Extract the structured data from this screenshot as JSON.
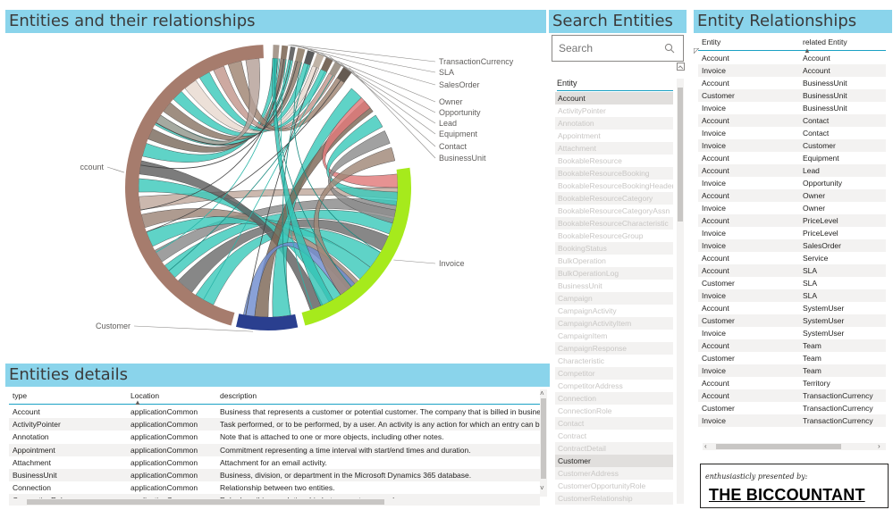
{
  "headers": {
    "chord": "Entities and their relationships",
    "search": "Search Entities",
    "relationships": "Entity Relationships",
    "details": "Entities details"
  },
  "search": {
    "placeholder": "Search",
    "list_header": "Entity"
  },
  "entity_list": [
    "Account",
    "ActivityPointer",
    "Annotation",
    "Appointment",
    "Attachment",
    "BookableResource",
    "BookableResourceBooking",
    "BookableResourceBookingHeader",
    "BookableResourceCategory",
    "BookableResourceCategoryAssn",
    "BookableResourceCharacteristic",
    "BookableResourceGroup",
    "BookingStatus",
    "BulkOperation",
    "BulkOperationLog",
    "BusinessUnit",
    "Campaign",
    "CampaignActivity",
    "CampaignActivityItem",
    "CampaignItem",
    "CampaignResponse",
    "Characteristic",
    "Competitor",
    "CompetitorAddress",
    "Connection",
    "ConnectionRole",
    "Contact",
    "Contract",
    "ContractDetail",
    "Customer",
    "CustomerAddress",
    "CustomerOpportunityRole",
    "CustomerRelationship"
  ],
  "entity_list_selected": [
    "Account",
    "Customer"
  ],
  "relationships": {
    "columns": [
      "Entity",
      "related Entity"
    ],
    "rows": [
      [
        "Account",
        "Account"
      ],
      [
        "Invoice",
        "Account"
      ],
      [
        "Account",
        "BusinessUnit"
      ],
      [
        "Customer",
        "BusinessUnit"
      ],
      [
        "Invoice",
        "BusinessUnit"
      ],
      [
        "Account",
        "Contact"
      ],
      [
        "Invoice",
        "Contact"
      ],
      [
        "Invoice",
        "Customer"
      ],
      [
        "Account",
        "Equipment"
      ],
      [
        "Account",
        "Lead"
      ],
      [
        "Invoice",
        "Opportunity"
      ],
      [
        "Account",
        "Owner"
      ],
      [
        "Invoice",
        "Owner"
      ],
      [
        "Account",
        "PriceLevel"
      ],
      [
        "Invoice",
        "PriceLevel"
      ],
      [
        "Invoice",
        "SalesOrder"
      ],
      [
        "Account",
        "Service"
      ],
      [
        "Account",
        "SLA"
      ],
      [
        "Customer",
        "SLA"
      ],
      [
        "Invoice",
        "SLA"
      ],
      [
        "Account",
        "SystemUser"
      ],
      [
        "Customer",
        "SystemUser"
      ],
      [
        "Invoice",
        "SystemUser"
      ],
      [
        "Account",
        "Team"
      ],
      [
        "Customer",
        "Team"
      ],
      [
        "Invoice",
        "Team"
      ],
      [
        "Account",
        "Territory"
      ],
      [
        "Account",
        "TransactionCurrency"
      ],
      [
        "Customer",
        "TransactionCurrency"
      ],
      [
        "Invoice",
        "TransactionCurrency"
      ]
    ]
  },
  "details": {
    "columns": [
      "type",
      "Location",
      "description"
    ],
    "rows": [
      [
        "Account",
        "applicationCommon",
        "Business that represents a customer or potential customer. The company that is billed in business t"
      ],
      [
        "ActivityPointer",
        "applicationCommon",
        "Task performed, or to be performed, by a user. An activity is any action for which an entry can be m"
      ],
      [
        "Annotation",
        "applicationCommon",
        "Note that is attached to one or more objects, including other notes."
      ],
      [
        "Appointment",
        "applicationCommon",
        "Commitment representing a time interval with start/end times and duration."
      ],
      [
        "Attachment",
        "applicationCommon",
        "Attachment for an email activity."
      ],
      [
        "BusinessUnit",
        "applicationCommon",
        "Business, division, or department in the Microsoft Dynamics 365 database."
      ],
      [
        "Connection",
        "applicationCommon",
        "Relationship between two entities."
      ],
      [
        "ConnectionRole",
        "applicationCommon",
        "Role describing a relationship between a two records."
      ]
    ]
  },
  "chord_labels": [
    "TransactionCurrency",
    "SLA",
    "SalesOrder",
    "Owner",
    "Opportunity",
    "Lead",
    "Equipment",
    "Contact",
    "BusinessUnit",
    "Account",
    "Invoice",
    "Customer"
  ],
  "colors": {
    "header_bg": "#8ad4eb",
    "account_arc": "#a67c6d",
    "invoice_arc": "#a6ea1c",
    "customer_arc": "#2a3f8f",
    "teal_ribbon": "#3cc9bb",
    "accent_line": "#1ba1c4"
  },
  "brand": {
    "tagline": "enthusiasticly presented by:",
    "name": "THE BICCOUNTANT"
  }
}
